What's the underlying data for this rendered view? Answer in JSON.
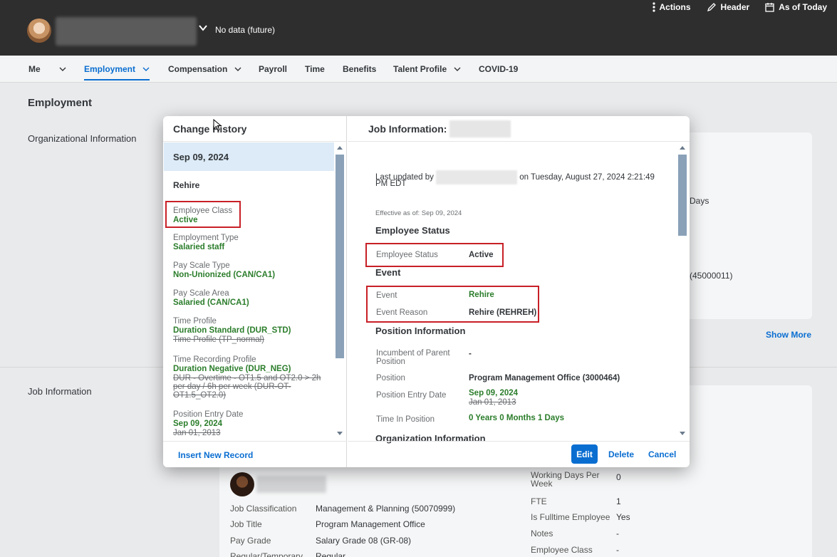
{
  "header": {
    "no_data": "No data (future)",
    "actions": [
      "Actions",
      "Header",
      "As of Today"
    ]
  },
  "tabs": [
    {
      "label": "Me",
      "dropdown": true
    },
    {
      "label": "Employment",
      "dropdown": true,
      "active": true
    },
    {
      "label": "Compensation",
      "dropdown": true
    },
    {
      "label": "Payroll",
      "dropdown": false
    },
    {
      "label": "Time",
      "dropdown": false
    },
    {
      "label": "Benefits",
      "dropdown": false
    },
    {
      "label": "Talent Profile",
      "dropdown": true
    },
    {
      "label": "COVID-19",
      "dropdown": false
    }
  ],
  "page": {
    "title": "Employment",
    "org_section": "Organizational Information",
    "job_section": "Job Information",
    "show_more": "Show More",
    "bg_fragments": [
      "Days",
      "(45000011)"
    ],
    "job_left": [
      {
        "label": "Job Classification",
        "value": "Management & Planning (50070999)"
      },
      {
        "label": "Job Title",
        "value": "Program Management Office"
      },
      {
        "label": "Pay Grade",
        "value": "Salary Grade 08 (GR-08)"
      },
      {
        "label": "Regular/Temporary",
        "value": "Regular"
      }
    ],
    "job_right": [
      {
        "label": "Working Days Per Week",
        "value": "0"
      },
      {
        "label": "FTE",
        "value": "1"
      },
      {
        "label": "Is Fulltime Employee",
        "value": "Yes"
      },
      {
        "label": "Notes",
        "value": "-"
      },
      {
        "label": "Employee Class",
        "value": "-"
      }
    ]
  },
  "dialog": {
    "left_title": "Change History",
    "selected_date": "Sep 09, 2024",
    "event": "Rehire",
    "changes": {
      "employee_class": {
        "label": "Employee Class",
        "new": "Active"
      },
      "employment_type": {
        "label": "Employment Type",
        "new": "Salaried staff"
      },
      "pay_scale_type": {
        "label": "Pay Scale Type",
        "new": "Non-Unionized (CAN/CA1)"
      },
      "pay_scale_area": {
        "label": "Pay Scale Area",
        "new": "Salaried (CAN/CA1)"
      },
      "time_profile": {
        "label": "Time Profile",
        "new": "Duration Standard (DUR_STD)",
        "old": "Time Profile (TP_normal)"
      },
      "time_recording": {
        "label": "Time Recording Profile",
        "new": "Duration Negative (DUR_NEG)",
        "old_1": "DUR - Overtime - OT1.5 and OT2.0 > 2h",
        "old_2": "per day / 6h per week (DUR-OT-",
        "old_3": "OT1.5_OT2.0)"
      },
      "position_entry": {
        "label": "Position Entry Date",
        "new": "Sep 09, 2024",
        "old": "Jan 01, 2013"
      }
    },
    "insert_new_record": "Insert New Record",
    "right_title": "Job Information:",
    "last_updated_prefix": "Last updated by",
    "last_updated_suffix": "on Tuesday, August 27, 2024 2:21:49",
    "last_updated_tz": "PM EDT",
    "effective": "Effective as of: Sep 09, 2024",
    "employee_status_heading": "Employee Status",
    "employee_status_label": "Employee Status",
    "employee_status_value": "Active",
    "event_heading": "Event",
    "event_label": "Event",
    "event_value": "Rehire",
    "event_reason_label": "Event Reason",
    "event_reason_value": "Rehire (REHREH)",
    "position_heading": "Position Information",
    "incumbent_label_1": "Incumbent of Parent",
    "incumbent_label_2": "Position",
    "incumbent_value": "-",
    "position_label": "Position",
    "position_value": "Program Management Office (3000464)",
    "position_entry_label": "Position Entry Date",
    "position_entry_new": "Sep 09, 2024",
    "position_entry_old": "Jan 01, 2013",
    "time_in_position_label": "Time In Position",
    "time_in_position_value": "0 Years 0 Months 1 Days",
    "org_heading": "Organization Information",
    "buttons": {
      "edit": "Edit",
      "delete": "Delete",
      "cancel": "Cancel"
    }
  },
  "colors": {
    "accent": "#0a6ed1",
    "changed": "#2b7d2b",
    "highlight": "#c82027",
    "topbar": "#2e2e2e"
  }
}
